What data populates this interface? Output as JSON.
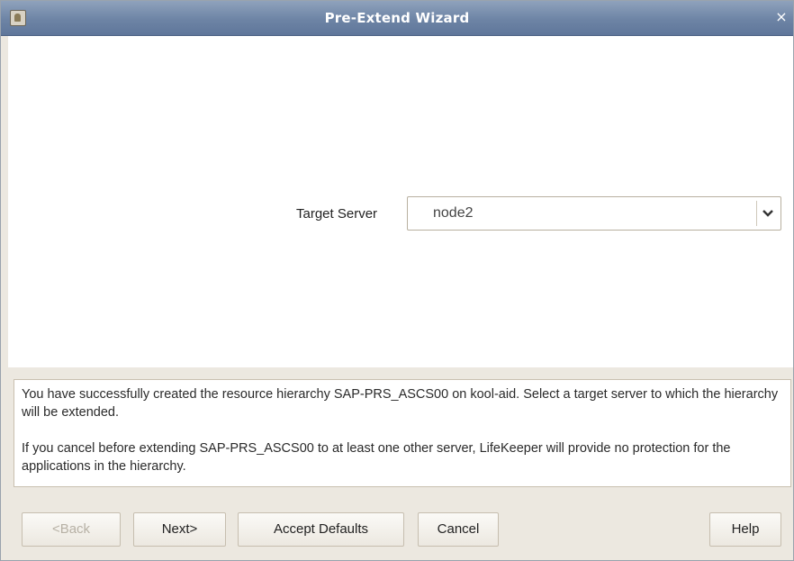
{
  "window": {
    "title": "Pre-Extend Wizard",
    "close_label": "×"
  },
  "form": {
    "target_server_label": "Target Server",
    "target_server_value": "node2"
  },
  "message": {
    "line1": "You have successfully created the resource hierarchy SAP-PRS_ASCS00 on kool-aid. Select a target server to which the hierarchy will be extended.",
    "line2": "If you cancel before extending SAP-PRS_ASCS00 to at least one other server, LifeKeeper will provide no protection for the applications in the hierarchy."
  },
  "buttons": {
    "back": "<Back",
    "next": "Next>",
    "accept_defaults": "Accept Defaults",
    "cancel": "Cancel",
    "help": "Help"
  },
  "icons": {
    "window_icon": "app-window-icon",
    "dropdown": "chevron-down-icon"
  },
  "colors": {
    "titlebar": "#6d84a5",
    "dialog_bg": "#ece8e0",
    "content_bg": "#ffffff"
  }
}
